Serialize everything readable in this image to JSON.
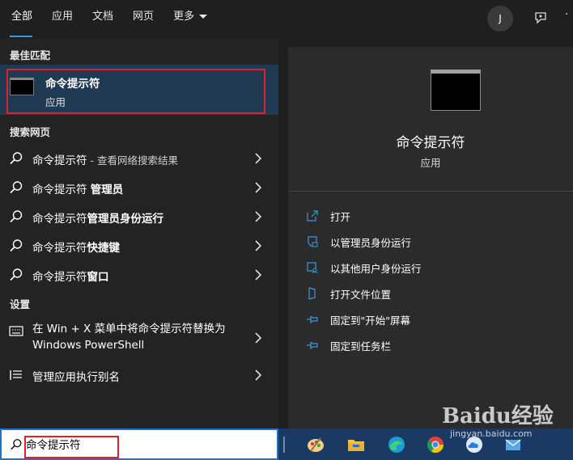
{
  "tabs": [
    {
      "label": "全部"
    },
    {
      "label": "应用"
    },
    {
      "label": "文档"
    },
    {
      "label": "网页"
    },
    {
      "label": "更多"
    }
  ],
  "user": {
    "initial": "J"
  },
  "sections": {
    "best_match": "最佳匹配",
    "web": "搜索网页",
    "settings": "设置"
  },
  "best_match": {
    "title": "命令提示符",
    "subtitle": "应用"
  },
  "web_results": [
    {
      "prefix": "命令提示符",
      "suffix": "",
      "hint": " - 查看网络搜索结果"
    },
    {
      "prefix": "命令提示符 ",
      "suffix": "管理员",
      "hint": ""
    },
    {
      "prefix": "命令提示符",
      "suffix": "管理员身份运行",
      "hint": ""
    },
    {
      "prefix": "命令提示符",
      "suffix": "快捷键",
      "hint": ""
    },
    {
      "prefix": "命令提示符",
      "suffix": "窗口",
      "hint": ""
    }
  ],
  "settings_results": [
    {
      "label": "在 Win + X 菜单中将命令提示符替换为 Windows PowerShell"
    },
    {
      "label": "管理应用执行别名"
    }
  ],
  "preview": {
    "title": "命令提示符",
    "subtitle": "应用",
    "actions": [
      {
        "label": "打开",
        "icon": "open-icon"
      },
      {
        "label": "以管理员身份运行",
        "icon": "shield-icon"
      },
      {
        "label": "以其他用户身份运行",
        "icon": "user-icon"
      },
      {
        "label": "打开文件位置",
        "icon": "folder-location-icon"
      },
      {
        "label": "固定到\"开始\"屏幕",
        "icon": "pin-icon"
      },
      {
        "label": "固定到任务栏",
        "icon": "pin-icon"
      }
    ]
  },
  "search": {
    "value": "命令提示符"
  },
  "watermark": {
    "brand": "Baidu经验",
    "url": "jingyan.baidu.com"
  },
  "colors": {
    "accent": "#3a9bdc",
    "highlight": "#1f3a52",
    "annotation": "#e0212a",
    "taskbar": "#1a3a63"
  }
}
